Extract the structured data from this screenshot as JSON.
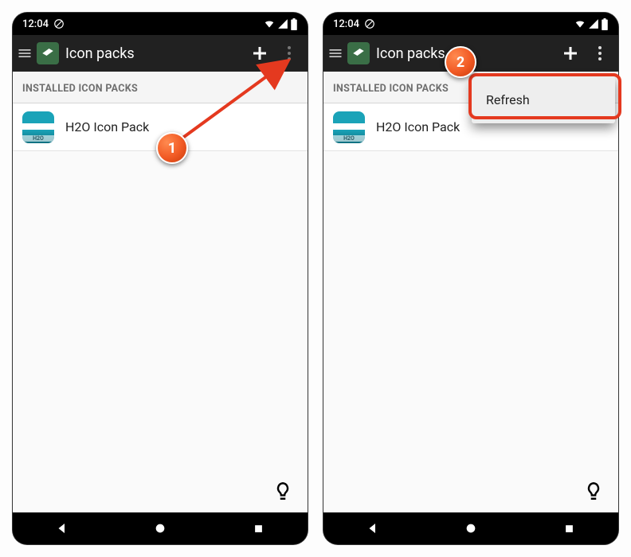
{
  "statusbar": {
    "time": "12:04"
  },
  "appbar": {
    "title": "Icon packs"
  },
  "section": {
    "header": "INSTALLED ICON PACKS"
  },
  "items": [
    {
      "label": "H2O Icon Pack"
    }
  ],
  "menu": {
    "refresh": "Refresh"
  },
  "callouts": {
    "one": "1",
    "two": "2"
  }
}
